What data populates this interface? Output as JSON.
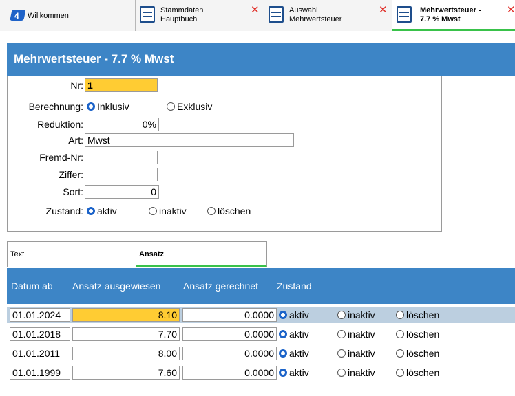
{
  "tabs": [
    {
      "line1": "Willkommen",
      "line2": ""
    },
    {
      "line1": "Stammdaten",
      "line2": "Hauptbuch"
    },
    {
      "line1": "Auswahl",
      "line2": "Mehrwertsteuer"
    },
    {
      "line1": "Mehrwertsteuer -",
      "line2": "7.7 % Mwst"
    }
  ],
  "close_glyph": "✕",
  "header": {
    "title": "Mehrwertsteuer - 7.7 % Mwst"
  },
  "form": {
    "nr_label": "Nr:",
    "nr_value": "1",
    "berechnung_label": "Berechnung:",
    "inklusiv": "Inklusiv",
    "exklusiv": "Exklusiv",
    "reduktion_label": "Reduktion:",
    "reduktion_value": "0%",
    "art_label": "Art:",
    "art_value": "Mwst",
    "fremd_label": "Fremd-Nr:",
    "fremd_value": "",
    "ziffer_label": "Ziffer:",
    "ziffer_value": "",
    "sort_label": "Sort:",
    "sort_value": "0",
    "zustand_label": "Zustand:",
    "aktiv": "aktiv",
    "inaktiv": "inaktiv",
    "loeschen": "löschen"
  },
  "subtabs": {
    "text": "Text",
    "ansatz": "Ansatz"
  },
  "grid": {
    "columns": [
      "Datum ab",
      "Ansatz ausgewiesen",
      "Ansatz gerechnet",
      "Zustand"
    ],
    "rows": [
      {
        "datum": "01.01.2024",
        "ausgewiesen": "8.10",
        "gerechnet": "0.0000",
        "aktiv": "aktiv",
        "inaktiv": "inaktiv",
        "loeschen": "löschen"
      },
      {
        "datum": "01.01.2018",
        "ausgewiesen": "7.70",
        "gerechnet": "0.0000",
        "aktiv": "aktiv",
        "inaktiv": "inaktiv",
        "loeschen": "löschen"
      },
      {
        "datum": "01.01.2011",
        "ausgewiesen": "8.00",
        "gerechnet": "0.0000",
        "aktiv": "aktiv",
        "inaktiv": "inaktiv",
        "loeschen": "löschen"
      },
      {
        "datum": "01.01.1999",
        "ausgewiesen": "7.60",
        "gerechnet": "0.0000",
        "aktiv": "aktiv",
        "inaktiv": "inaktiv",
        "loeschen": "löschen"
      }
    ]
  },
  "colors": {
    "header_blue": "#3d85c6",
    "highlight": "#ffcc33",
    "active_green": "#39c24a",
    "close_red": "#e0302a",
    "selected_row": "#bccfe0"
  }
}
